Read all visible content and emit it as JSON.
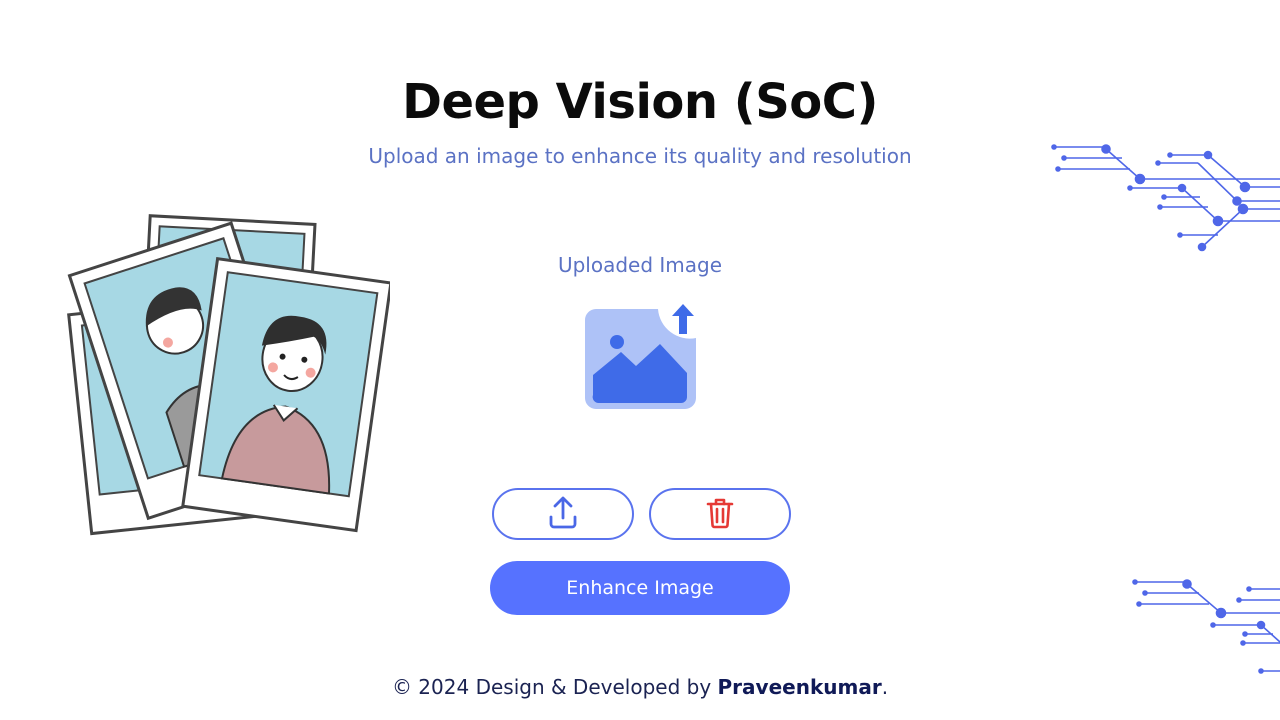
{
  "header": {
    "title": "Deep Vision (SoC)",
    "subtitle": "Upload an image to enhance its quality and resolution"
  },
  "preview": {
    "label": "Uploaded Image",
    "icon": "image-upload-icon"
  },
  "actions": {
    "upload_icon": "upload-icon",
    "delete_icon": "trash-icon",
    "enhance_label": "Enhance Image"
  },
  "footer": {
    "prefix": "© 2024 Design & Developed by ",
    "author": "Praveenkumar",
    "suffix": "."
  },
  "colors": {
    "accent": "#5672ff",
    "outline": "#5a73ee",
    "subtitle": "#5b72c4",
    "delete": "#e53935",
    "circuit": "#4f67e8"
  }
}
